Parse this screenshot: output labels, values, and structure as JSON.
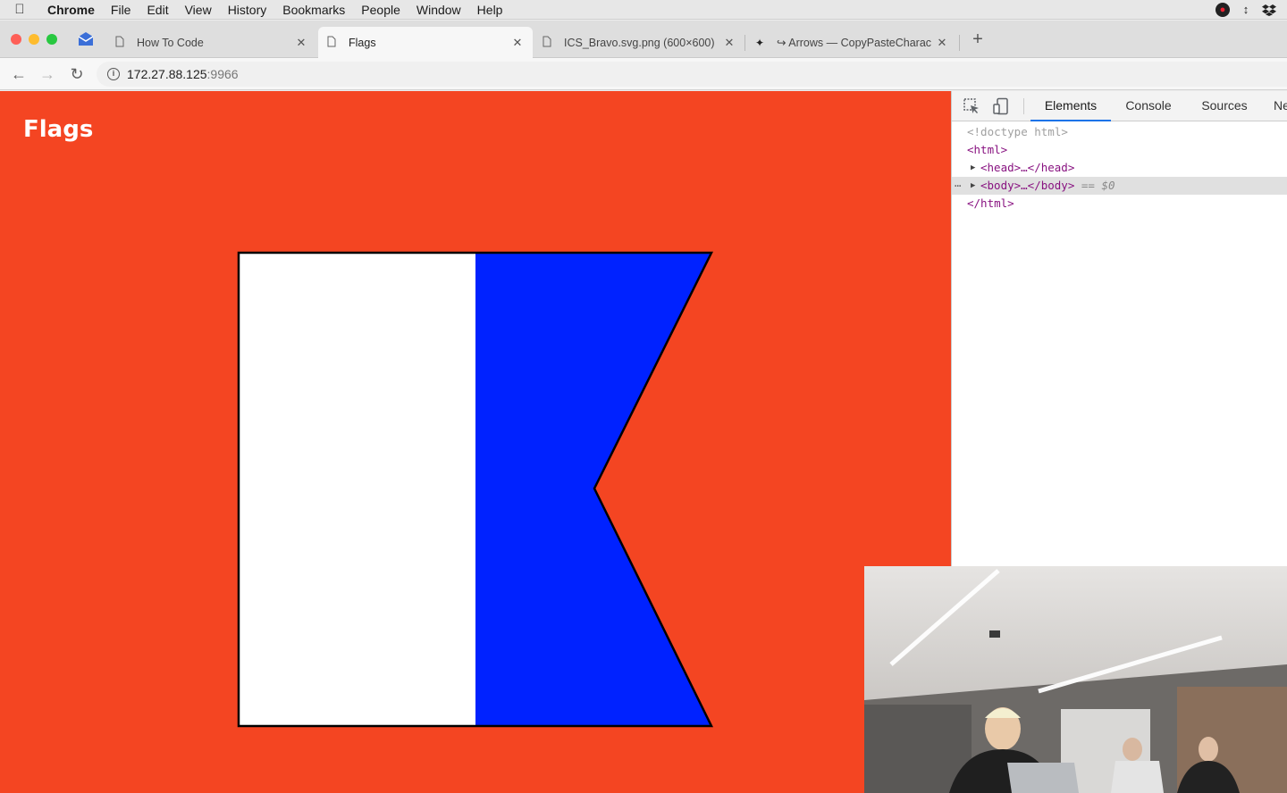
{
  "menubar": {
    "app": "Chrome",
    "items": [
      "File",
      "Edit",
      "View",
      "History",
      "Bookmarks",
      "People",
      "Window",
      "Help"
    ]
  },
  "tabs": [
    {
      "title": "How To Code",
      "icon": "page-icon"
    },
    {
      "title": "Flags",
      "icon": "page-icon",
      "active": true
    },
    {
      "title": "ICS_Bravo.svg.png (600×600)",
      "icon": "page-icon"
    },
    {
      "title": "↪ Arrows — CopyPasteCharac",
      "icon": "bird-icon"
    }
  ],
  "address_bar": {
    "host": "172.27.88.125",
    "port": ":9966"
  },
  "page": {
    "title": "Flags",
    "background": "#f44522",
    "flag": {
      "name": "Alfa",
      "hoist_color": "#ffffff",
      "fly_color": "#0022ff",
      "outline_color": "#000000"
    }
  },
  "devtools": {
    "tabs": [
      "Elements",
      "Console",
      "Sources",
      "Ne"
    ],
    "active_tab": "Elements",
    "tree": {
      "doctype": "<!doctype html>",
      "html_open": "<html>",
      "head": "<head>…</head>",
      "body": "<body>…</body>",
      "selected_eq": "==",
      "selected_ref": "$0",
      "html_close": "</html>"
    }
  },
  "colors": {
    "accent": "#1a73e8",
    "page_bg": "#f44522"
  }
}
